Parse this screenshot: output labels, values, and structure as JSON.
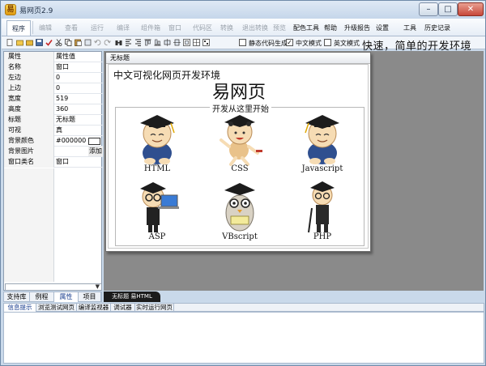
{
  "window": {
    "title": "易网页2.9",
    "controls": {
      "minimize": "–",
      "maximize": "□",
      "close": "✕"
    }
  },
  "menubar": {
    "items": [
      {
        "label": "程序",
        "enabled": true,
        "active": true
      },
      {
        "label": "编辑",
        "enabled": false
      },
      {
        "label": "查看",
        "enabled": false
      },
      {
        "label": "运行",
        "enabled": false
      },
      {
        "label": "编译",
        "enabled": false
      },
      {
        "label": "组件箱",
        "enabled": false
      },
      {
        "label": "窗口",
        "enabled": false
      },
      {
        "label": "代码区",
        "enabled": false
      },
      {
        "label": "转换",
        "enabled": false
      },
      {
        "label": "退出转换",
        "enabled": false
      },
      {
        "label": "预览",
        "enabled": false
      },
      {
        "label": "配色工具",
        "enabled": true
      },
      {
        "label": "帮助",
        "enabled": true
      },
      {
        "label": "升级报告",
        "enabled": true
      },
      {
        "label": "设置",
        "enabled": true
      },
      {
        "label": "工具",
        "enabled": true
      },
      {
        "label": "历史记录",
        "enabled": true
      }
    ]
  },
  "toolbar": {
    "options": [
      {
        "label": "静态代码生成",
        "checked": false
      },
      {
        "label": "中文模式",
        "checked": true
      },
      {
        "label": "英文模式",
        "checked": false
      }
    ],
    "slogan": "快速，简单的开发环境"
  },
  "properties": {
    "rows": [
      {
        "key": "属性",
        "value": "属性值"
      },
      {
        "key": "名称",
        "value": "窗口"
      },
      {
        "key": "左边",
        "value": "0"
      },
      {
        "key": "上边",
        "value": "0"
      },
      {
        "key": "宽度",
        "value": "519"
      },
      {
        "key": "高度",
        "value": "360"
      },
      {
        "key": "标题",
        "value": "无标题"
      },
      {
        "key": "可视",
        "value": "真"
      },
      {
        "key": "背景颜色",
        "value": "#000000"
      },
      {
        "key": "背景图片",
        "value": ""
      },
      {
        "key": "窗口类名",
        "value": "窗口"
      }
    ],
    "add_button": "添加"
  },
  "left_tabs": [
    {
      "label": "支持库",
      "active": false
    },
    {
      "label": "例程",
      "active": false
    },
    {
      "label": "属性",
      "active": true
    },
    {
      "label": "项目",
      "active": false
    }
  ],
  "form": {
    "window_title": "无标题",
    "heading": "中文可视化网页开发环境",
    "big_title": "易网页",
    "legend": "开发从这里开始",
    "items": [
      {
        "label": "HTML"
      },
      {
        "label": "CSS"
      },
      {
        "label": "Javascript"
      },
      {
        "label": "ASP"
      },
      {
        "label": "VBscript"
      },
      {
        "label": "PHP"
      }
    ]
  },
  "doc_tab": "无标题 易HTML",
  "bottom_tabs": [
    {
      "label": "信息提示",
      "active": true
    },
    {
      "label": "浏览测试网页",
      "active": false
    },
    {
      "label": "编译监视器",
      "active": false
    },
    {
      "label": "调试器",
      "active": false
    },
    {
      "label": "实时运行网页",
      "active": false
    }
  ]
}
